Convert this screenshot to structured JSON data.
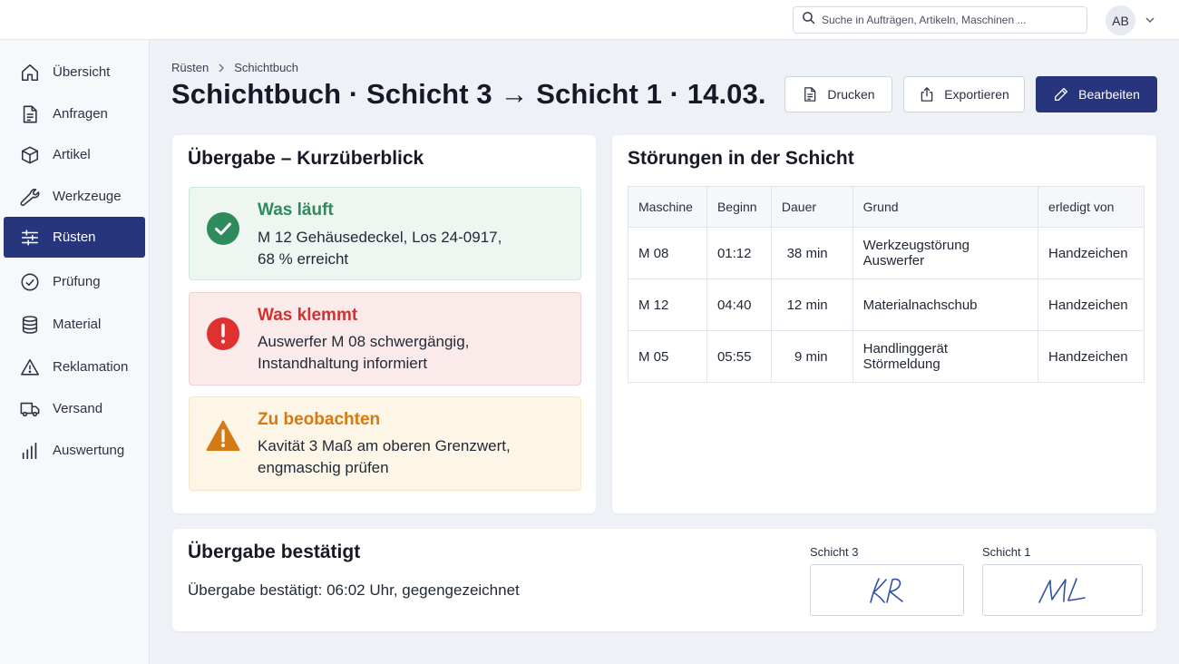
{
  "topbar": {
    "search_placeholder": "Suche in Aufträgen, Artikeln, Maschinen ...",
    "user_initials": "AB"
  },
  "sidebar": {
    "items": [
      {
        "label": "Übersicht",
        "icon": "home-icon"
      },
      {
        "label": "Anfragen",
        "icon": "document-icon"
      },
      {
        "label": "Artikel",
        "icon": "box-icon"
      },
      {
        "label": "Werkzeuge",
        "icon": "wrench-icon"
      },
      {
        "label": "Rüsten",
        "icon": "sliders-icon",
        "active": true
      },
      {
        "label": "Prüfung",
        "icon": "check-circle-icon"
      },
      {
        "label": "Material",
        "icon": "database-icon"
      },
      {
        "label": "Reklamation",
        "icon": "warning-icon"
      },
      {
        "label": "Versand",
        "icon": "truck-icon"
      },
      {
        "label": "Auswertung",
        "icon": "bar-chart-icon"
      }
    ]
  },
  "header": {
    "breadcrumb": [
      "Rüsten",
      "Schichtbuch"
    ],
    "title": "Schichtbuch · Schicht 3 → Schicht 1 · 14.03.",
    "buttons": {
      "print": "Drucken",
      "export": "Exportieren",
      "edit": "Bearbeiten"
    }
  },
  "handover": {
    "title": "Übergabe – Kurzüberblick",
    "running": {
      "title": "Was läuft",
      "line1": "M 12 Gehäusedeckel, Los 24-0917,",
      "line2": "68 % erreicht"
    },
    "blocking": {
      "title": "Was klemmt",
      "line1": "Auswerfer M 08 schwergängig,",
      "line2": "Instandhaltung informiert"
    },
    "watch": {
      "title": "Zu beobachten",
      "line1": "Kavität 3 Maß am oberen Grenzwert,",
      "line2": "engmaschig prüfen"
    }
  },
  "disruptions": {
    "title": "Störungen in der Schicht",
    "columns": [
      "Maschine",
      "Beginn",
      "Dauer",
      "Grund",
      "erledigt von"
    ],
    "rows": [
      [
        "M 08",
        "01:12",
        "38 min",
        "Werkzeugstörung Auswerfer",
        "Handzeichen"
      ],
      [
        "M 12",
        "04:40",
        "12 min",
        "Materialnachschub",
        "Handzeichen"
      ],
      [
        "M 05",
        "05:55",
        "9 min",
        "Handlinggerät Störmeldung",
        "Handzeichen"
      ]
    ]
  },
  "confirmation": {
    "title": "Übergabe bestätigt",
    "text": "Übergabe bestätigt: 06:02 Uhr, gegengezeichnet",
    "signatures": [
      {
        "label": "Schicht 3",
        "initials": "KR"
      },
      {
        "label": "Schicht 1",
        "initials": "ML"
      }
    ]
  },
  "colors": {
    "primary": "#27357d",
    "ok": "#2e8b5c",
    "error": "#e03131",
    "warning": "#d57914",
    "signature_ink": "#2f4fa8"
  }
}
